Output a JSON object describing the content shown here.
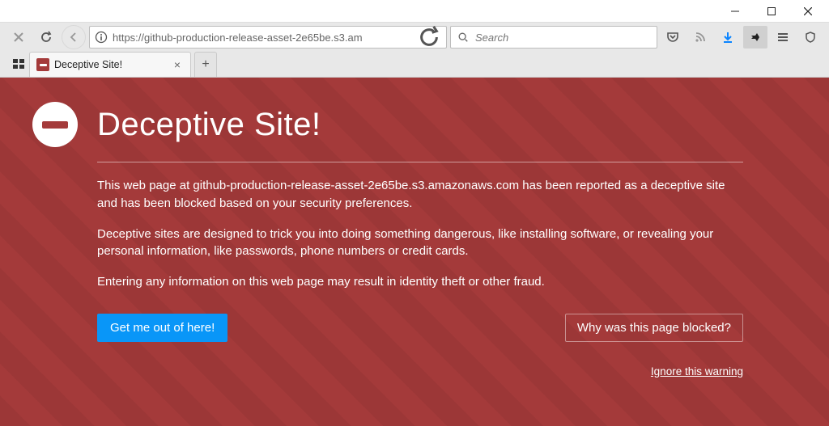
{
  "window": {
    "title": ""
  },
  "toolbar": {
    "url": "https://github-production-release-asset-2e65be.s3.am",
    "search_placeholder": "Search"
  },
  "tabs": {
    "active": {
      "title": "Deceptive Site!"
    }
  },
  "warning": {
    "heading": "Deceptive Site!",
    "para1": "This web page at github-production-release-asset-2e65be.s3.amazonaws.com has been reported as a deceptive site and has been blocked based on your security preferences.",
    "para2": "Deceptive sites are designed to trick you into doing something dangerous, like installing software, or revealing your personal information, like passwords, phone numbers or credit cards.",
    "para3": "Entering any information on this web page may result in identity theft or other fraud.",
    "primary_button": "Get me out of here!",
    "secondary_button": "Why was this page blocked?",
    "ignore_link": "Ignore this warning"
  },
  "colors": {
    "danger_bg": "#a43a3a",
    "primary_blue": "#0996f8"
  }
}
